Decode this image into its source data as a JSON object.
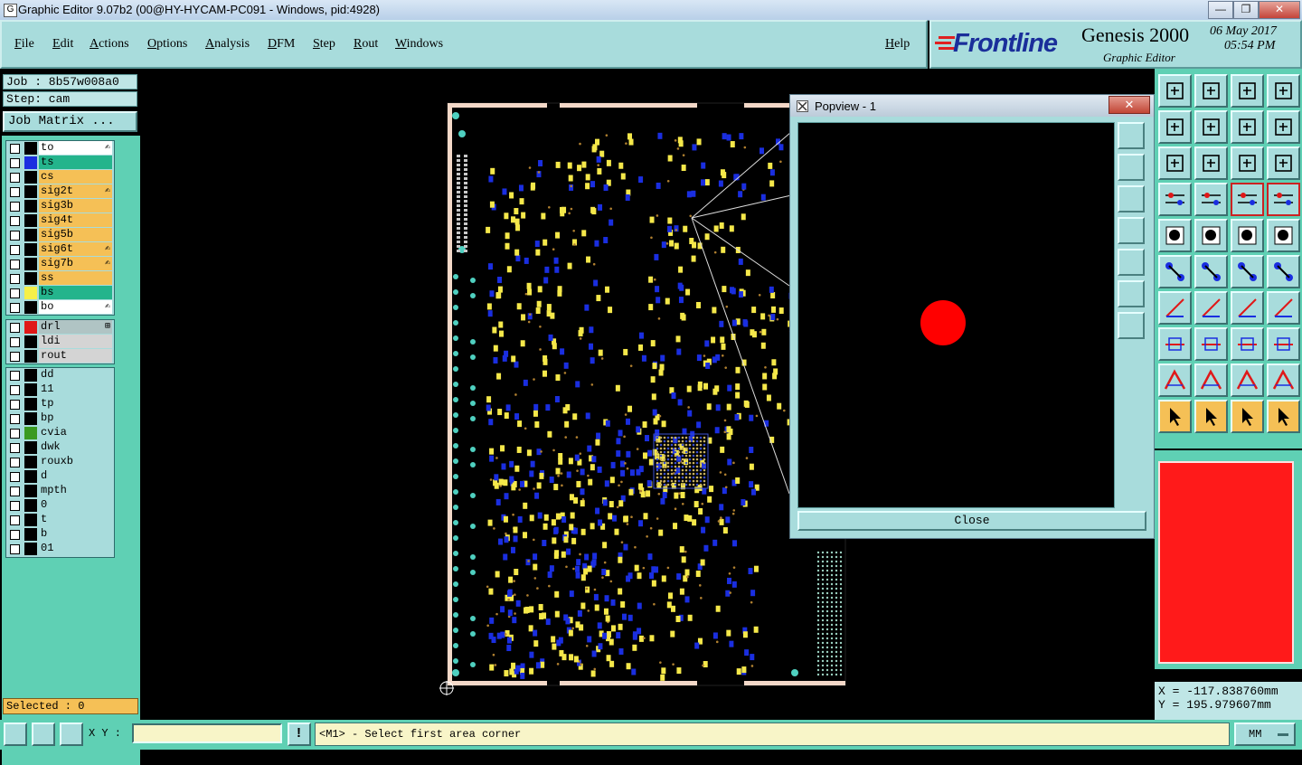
{
  "window": {
    "title": "Graphic Editor 9.07b2 (00@HY-HYCAM-PC091 - Windows, pid:4928)",
    "controls": [
      "minimize",
      "maximize",
      "close"
    ]
  },
  "menu": {
    "items": [
      {
        "label": "File"
      },
      {
        "label": "Edit"
      },
      {
        "label": "Actions"
      },
      {
        "label": "Options"
      },
      {
        "label": "Analysis"
      },
      {
        "label": "DFM"
      },
      {
        "label": "Step"
      },
      {
        "label": "Rout"
      },
      {
        "label": "Windows"
      }
    ],
    "help": "Help"
  },
  "brand": {
    "logo": "Frontline",
    "product": "Genesis 2000",
    "subtitle": "Graphic Editor",
    "date": "06 May 2017",
    "time": "05:54 PM"
  },
  "job": {
    "job_label": "Job : 8b57w008a0",
    "step_label": "Step: cam",
    "matrix_button": "Job Matrix ..."
  },
  "layers": {
    "board": [
      {
        "name": "to",
        "swatch": "#000000",
        "bg": "#ffffff",
        "mark": "✍"
      },
      {
        "name": "ts",
        "swatch": "#1a2ee0",
        "bg": "#24b48c",
        "mark": ""
      },
      {
        "name": "cs",
        "swatch": "#000000",
        "bg": "#f5c056",
        "mark": ""
      },
      {
        "name": "sig2t",
        "swatch": "#000000",
        "bg": "#f5c056",
        "mark": "✍"
      },
      {
        "name": "sig3b",
        "swatch": "#000000",
        "bg": "#f5c056",
        "mark": ""
      },
      {
        "name": "sig4t",
        "swatch": "#000000",
        "bg": "#f5c056",
        "mark": ""
      },
      {
        "name": "sig5b",
        "swatch": "#000000",
        "bg": "#f5c056",
        "mark": ""
      },
      {
        "name": "sig6t",
        "swatch": "#000000",
        "bg": "#f5c056",
        "mark": "✍"
      },
      {
        "name": "sig7b",
        "swatch": "#000000",
        "bg": "#f5c056",
        "mark": "✍"
      },
      {
        "name": "ss",
        "swatch": "#000000",
        "bg": "#f5c056",
        "mark": ""
      },
      {
        "name": "bs",
        "swatch": "#f5f048",
        "bg": "#24b48c",
        "mark": ""
      },
      {
        "name": "bo",
        "swatch": "#000000",
        "bg": "#ffffff",
        "mark": "✍"
      }
    ],
    "drill": [
      {
        "name": "drl",
        "swatch": "#e01818",
        "bg": "#b0c4c4",
        "mark": "⊞"
      },
      {
        "name": "ldi",
        "swatch": "#000000",
        "bg": "#d4d4d4",
        "mark": ""
      },
      {
        "name": "rout",
        "swatch": "#000000",
        "bg": "#d4d4d4",
        "mark": ""
      }
    ],
    "misc": [
      {
        "name": "dd",
        "swatch": "#000000",
        "bg": "#a8dcdc"
      },
      {
        "name": "11",
        "swatch": "#000000",
        "bg": "#a8dcdc"
      },
      {
        "name": "tp",
        "swatch": "#000000",
        "bg": "#a8dcdc"
      },
      {
        "name": "bp",
        "swatch": "#000000",
        "bg": "#a8dcdc"
      },
      {
        "name": "cvia",
        "swatch": "#3a9a20",
        "bg": "#a8dcdc"
      },
      {
        "name": "dwk",
        "swatch": "#000000",
        "bg": "#a8dcdc"
      },
      {
        "name": "rouxb",
        "swatch": "#000000",
        "bg": "#a8dcdc"
      },
      {
        "name": "d",
        "swatch": "#000000",
        "bg": "#a8dcdc"
      },
      {
        "name": "mpth",
        "swatch": "#000000",
        "bg": "#a8dcdc"
      },
      {
        "name": "0",
        "swatch": "#000000",
        "bg": "#a8dcdc"
      },
      {
        "name": "t",
        "swatch": "#000000",
        "bg": "#a8dcdc"
      },
      {
        "name": "b",
        "swatch": "#000000",
        "bg": "#a8dcdc"
      },
      {
        "name": "01",
        "swatch": "#000000",
        "bg": "#a8dcdc"
      }
    ]
  },
  "selected": "Selected : 0",
  "popview": {
    "title": "Popview - 1",
    "close_button": "Close",
    "dot_color": "#ff0000"
  },
  "coords": {
    "x": "X = -117.838760mm",
    "y": "Y = 195.979607mm"
  },
  "status": {
    "xy_label": "X Y :",
    "xy_value": "",
    "message": "<M1> - Select first area corner",
    "units": "MM"
  },
  "colors": {
    "panel": "#a8dcdc",
    "panel_dark": "#5fd0b4",
    "signal_layer": "#f5c056",
    "copper_yellow": "#f5e84a",
    "copper_blue": "#1a2ee0"
  }
}
